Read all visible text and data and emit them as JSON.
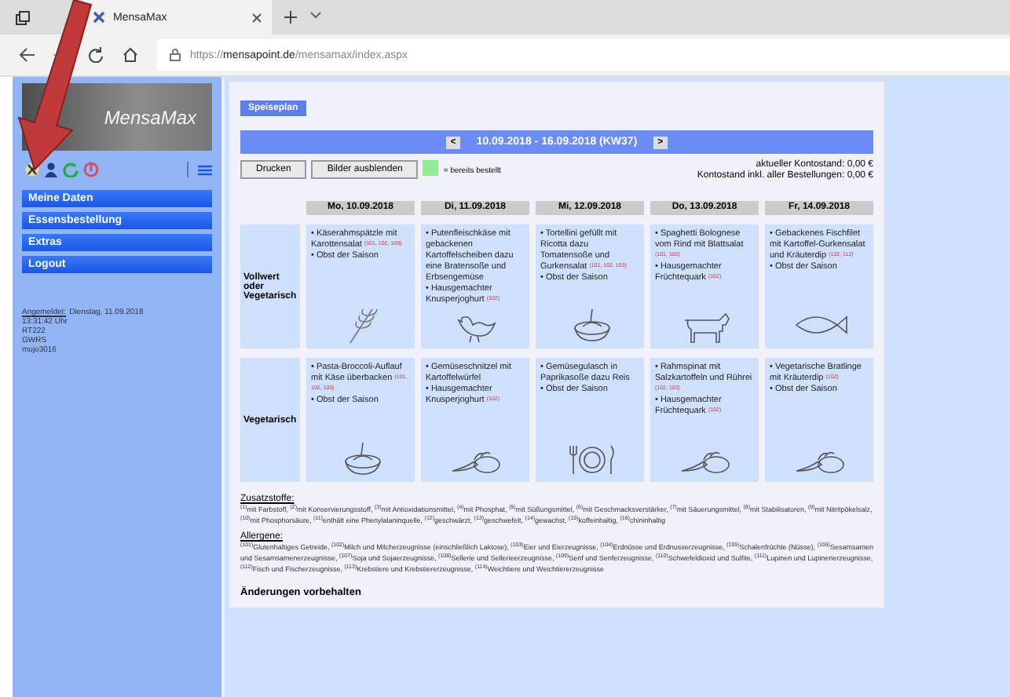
{
  "browser": {
    "tab_title": "MensaMax",
    "url_scheme": "https://",
    "url_host": "mensapoint.de",
    "url_path": "/mensamax/index.aspx"
  },
  "sidebar": {
    "logo_text": "MensaMax",
    "menu": [
      {
        "label": "Meine Daten"
      },
      {
        "label": "Essensbestellung"
      },
      {
        "label": "Extras"
      },
      {
        "label": "Logout"
      }
    ],
    "login_label": "Angemeldet:",
    "login_lines": [
      "Dienstag, 11.09.2018",
      "13:31:42 Uhr",
      "RT222",
      "GWRS",
      "mujo3016"
    ]
  },
  "main": {
    "tab": "Speiseplan",
    "week": {
      "prev": "<",
      "label": "10.09.2018 - 16.09.2018 (KW37)",
      "next": ">"
    },
    "buttons": [
      "Drucken",
      "Bilder ausblenden"
    ],
    "legend": {
      "color": "#90ee90",
      "text": "= bereits bestellt"
    },
    "balance": [
      "aktueller Kontostand: 0,00 €",
      "Kontostand inkl. aller Bestellungen: 0,00 €"
    ],
    "days": [
      "Mo, 10.09.2018",
      "Di, 11.09.2018",
      "Mi, 12.09.2018",
      "Do, 13.09.2018",
      "Fr, 14.09.2018"
    ],
    "rows": [
      {
        "label": "Vollwert oder Vegetarisch",
        "cells": [
          {
            "kind": "wheat",
            "items": [
              "• Käserahmspätzle mit Karottensalat $^{(101, 102, 109)}$",
              "• Obst der Saison"
            ]
          },
          {
            "kind": "chicken",
            "items": [
              "• Putenfleischkäse mit gebackenen Kartoffelscheiben dazu eine Bratensoße und Erbsengemüse",
              "• Hausgemachter Knusperjoghurt $^{(102)}$"
            ]
          },
          {
            "kind": "pasta",
            "items": [
              "• Tortellini gefüllt mit Ricotta dazu Tomatensoße und Gurkensalat $^{(101, 102, 103)}$",
              "• Obst der Saison"
            ]
          },
          {
            "kind": "cow",
            "items": [
              "• Spaghetti Bolognese vom Rind mit Blattsalat $^{(101, 102)}$",
              "• Hausgemachter Früchtequark $^{(102)}$"
            ]
          },
          {
            "kind": "fish",
            "items": [
              "• Gebackenes Fischfilet mit Kartoffel-Gurkensalat und Kräuterdip $^{(102, 112)}$",
              "• Obst der Saison"
            ]
          }
        ]
      },
      {
        "label": "Vegetarisch",
        "cells": [
          {
            "kind": "pasta",
            "items": [
              "• Pasta-Broccoli-Auflauf mit Käse überbacken $^{(101, 102, 103)}$",
              "• Obst der Saison"
            ]
          },
          {
            "kind": "vegetables",
            "items": [
              "• Gemüseschnitzel mit Kartoffelwürfel",
              "• Hausgemachter Knusperjoghurt $^{(102)}$"
            ]
          },
          {
            "kind": "plate",
            "items": [
              "• Gemüsegulasch in Paprikasoße dazu Reis",
              "• Obst der Saison"
            ]
          },
          {
            "kind": "vegetables",
            "items": [
              "• Rahmspinat mit Salzkartoffeln und Rührei $^{(102, 103)}$",
              "• Hausgemachter Früchtequark $^{(102)}$"
            ]
          },
          {
            "kind": "vegetables",
            "items": [
              "• Vegetarische Bratlinge mit Kräuterdip $^{(102)}$",
              "• Obst der Saison"
            ]
          }
        ]
      }
    ],
    "notes": [
      {
        "heading": "Zusatzstoffe:",
        "text": "$^{(1)}$mit Farbstoff, $^{(2)}$mit Konservierungsstoff, $^{(3)}$mit Antioxidationsmittel, $^{(4)}$mit Phosphat, $^{(5)}$mit Süßungsmittel, $^{(6)}$mit Geschmacksverstärker, $^{(7)}$mit Säuerungsmittel, $^{(8)}$mit Stabilisatoren, $^{(9)}$mit Nitritpökelsalz, $^{(10)}$mit Phosphorsäure, $^{(11)}$enthält eine Phenylalaninquelle, $^{(12)}$geschwärzt, $^{(13)}$geschwefelt, $^{(14)}$gewachst, $^{(15)}$koffeinhaltig, $^{(16)}$chininhaltig"
      },
      {
        "heading": "Allergene:",
        "text": "$^{(101)}$Glutenhaltiges Getreide, $^{(102)}$Milch und Milcherzeugnisse (einschließlich Laktose), $^{(103)}$Eier und Eierzeugnisse, $^{(104)}$Erdnüsse und Erdnusserzeugnisse, $^{(105)}$Schalenfrüchte (Nüsse), $^{(106)}$Sesamsamen und Sesamsamenerzeugnisse, $^{(107)}$Soja und Sojaerzeugnisse, $^{(108)}$Sellerie und Sellerieerzeugnisse, $^{(109)}$Senf und Senferzeugnisse, $^{(110)}$Schwefeldioxid und Sulfite, $^{(111)}$Lupinen und Lupinenerzeugnisse, $^{(112)}$Fisch und Fischerzeugnisse, $^{(113)}$Krebstiere und Krebstiererzeugnisse, $^{(114)}$Weichtiere und Weichtiererzeugnisse"
      }
    ],
    "footer": "Änderungen vorbehalten"
  }
}
